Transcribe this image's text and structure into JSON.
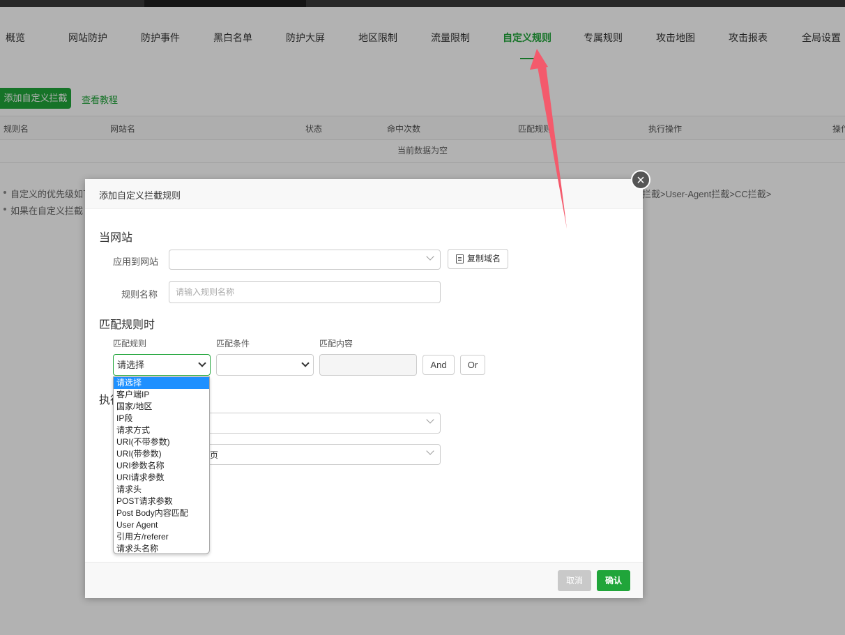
{
  "nav": {
    "tabs": [
      {
        "label": "概览"
      },
      {
        "label": "网站防护"
      },
      {
        "label": "防护事件"
      },
      {
        "label": "黑白名单"
      },
      {
        "label": "防护大屏"
      },
      {
        "label": "地区限制"
      },
      {
        "label": "流量限制"
      },
      {
        "label": "自定义规则",
        "active": true
      },
      {
        "label": "专属规则"
      },
      {
        "label": "攻击地图"
      },
      {
        "label": "攻击报表"
      },
      {
        "label": "全局设置"
      }
    ]
  },
  "toolbar": {
    "add_label": "添加自定义拦截",
    "tutorial_label": "查看教程"
  },
  "table": {
    "headers": [
      "规则名",
      "网站名",
      "状态",
      "命中次数",
      "匹配规则",
      "执行操作",
      "操作"
    ],
    "empty_text": "当前数据为空"
  },
  "notes": {
    "line1_left": "自定义的优先级如下",
    "line1_right": "拦截>User-Agent拦截>CC拦截>",
    "line2_left": "如果在自定义拦截"
  },
  "modal": {
    "title": "添加自定义拦截规则",
    "section_site": "当网站",
    "apply_label": "应用到网站",
    "copy_domain_label": "复制域名",
    "rule_name_label": "规则名称",
    "rule_name_placeholder": "请输入规则名称",
    "section_match": "匹配规则时",
    "col_rule": "匹配规则",
    "col_condition": "匹配条件",
    "col_content": "匹配内容",
    "rule_select_value": "请选择",
    "and_label": "And",
    "or_label": "Or",
    "section_exec_partial": "执行",
    "exec_select2_partial": "页",
    "dropdown_options": [
      "请选择",
      "客户端IP",
      "国家/地区",
      "IP段",
      "请求方式",
      "URI(不带参数)",
      "URI(带参数)",
      "URI参数名称",
      "URI请求参数",
      "请求头",
      "POST请求参数",
      "Post Body内容匹配",
      "User Agent",
      "引用方/referer",
      "请求头名称"
    ],
    "cancel_label": "取消",
    "confirm_label": "确认"
  },
  "colors": {
    "accent": "#20a53a",
    "selected_option": "#1e90ff",
    "arrow": "#f45a6c"
  }
}
